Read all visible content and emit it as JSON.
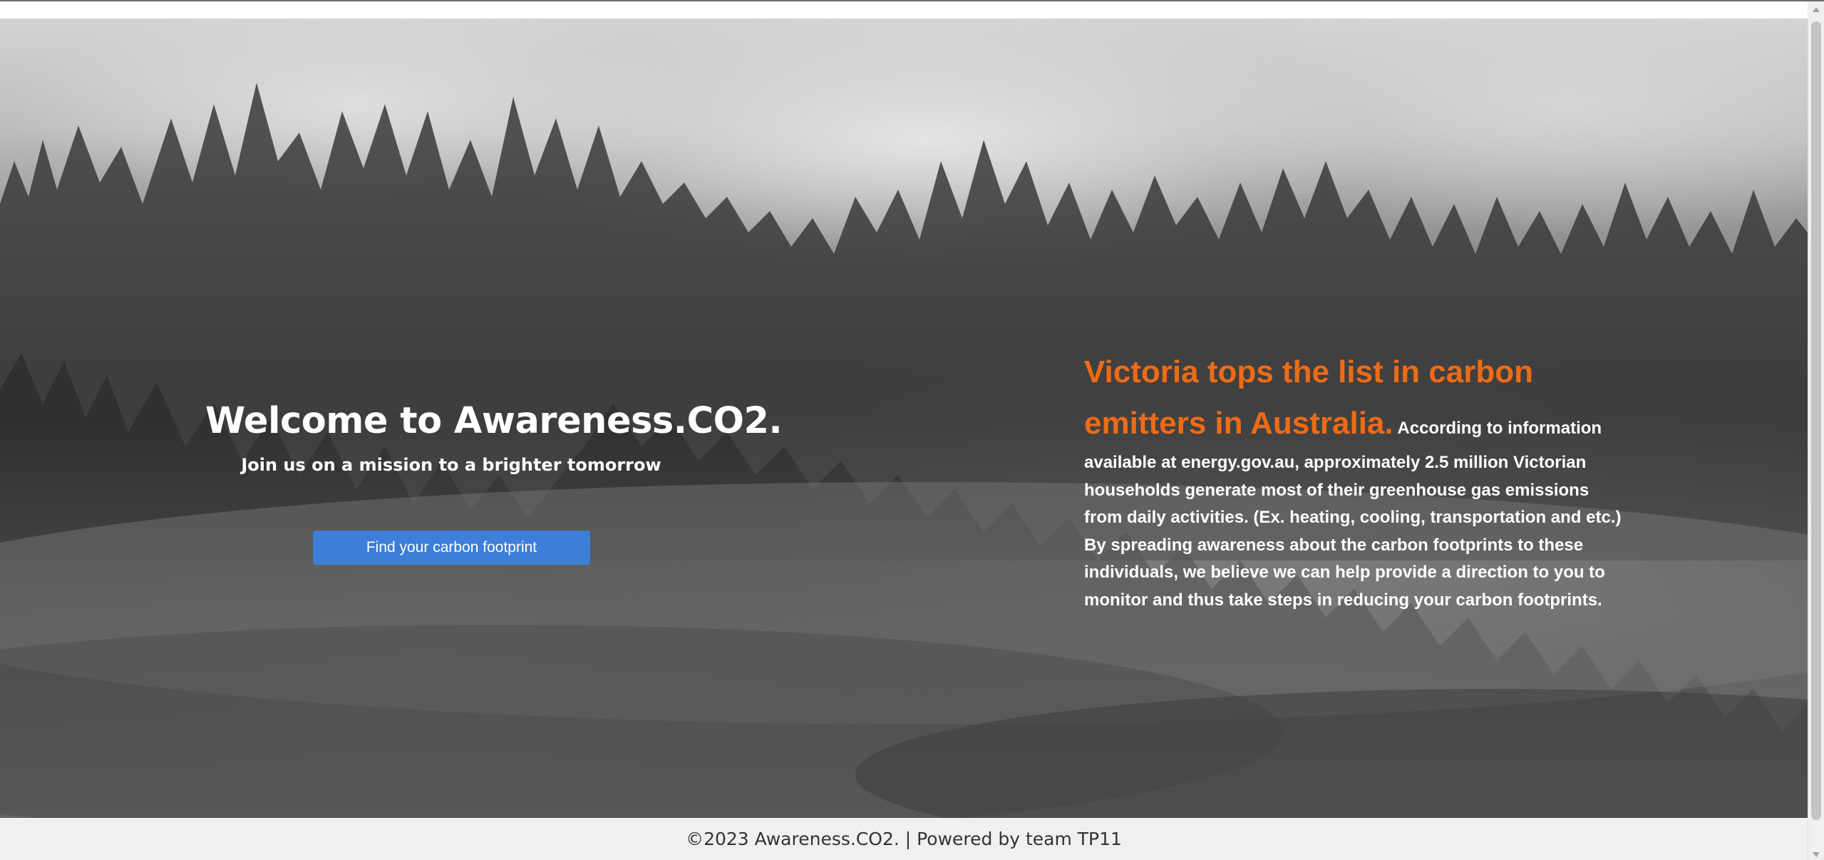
{
  "hero": {
    "title": "Welcome to Awareness.CO2.",
    "subtitle": "Join us on a mission to a brighter tomorrow",
    "cta_label": "Find your carbon footprint"
  },
  "info": {
    "heading": "Victoria tops the list in carbon emitters in Australia.",
    "body": "According to information available at energy.gov.au, approximately 2.5 million Victorian households generate most of their greenhouse gas emissions from daily activities. (Ex. heating, cooling, transportation and etc.) By spreading awareness about the carbon footprints to these individuals, we believe we can help provide a direction to you to monitor and thus take steps in reducing your carbon footprints."
  },
  "footer": {
    "text": "©2023 Awareness.CO2. | Powered by team TP11"
  },
  "colors": {
    "accent_orange": "#ee6b16",
    "button_blue": "#3d7ed8",
    "footer_bg": "#f0f0f0"
  },
  "icons": {
    "scroll_up": "chevron-up-icon",
    "scroll_down": "chevron-down-icon"
  }
}
